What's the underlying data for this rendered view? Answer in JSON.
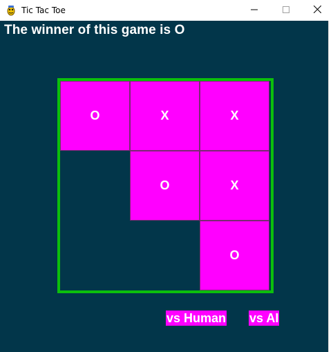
{
  "window": {
    "title": "Tic Tac Toe",
    "app_icon": "pygame-snake-icon",
    "controls": [
      "minimize-icon",
      "maximize-icon",
      "close-icon"
    ]
  },
  "game": {
    "status_text": "The winner of this game is O",
    "board": [
      [
        "O",
        "X",
        "X"
      ],
      [
        "",
        "O",
        "X"
      ],
      [
        "",
        "",
        "O"
      ]
    ],
    "winner": "O"
  },
  "buttons": {
    "vs_human": "vs Human",
    "vs_ai": "vs AI"
  },
  "colors": {
    "background": "#02364a",
    "board_border": "#0cbf0c",
    "filled_cell": "#ff00ff",
    "text": "#ffffff"
  }
}
